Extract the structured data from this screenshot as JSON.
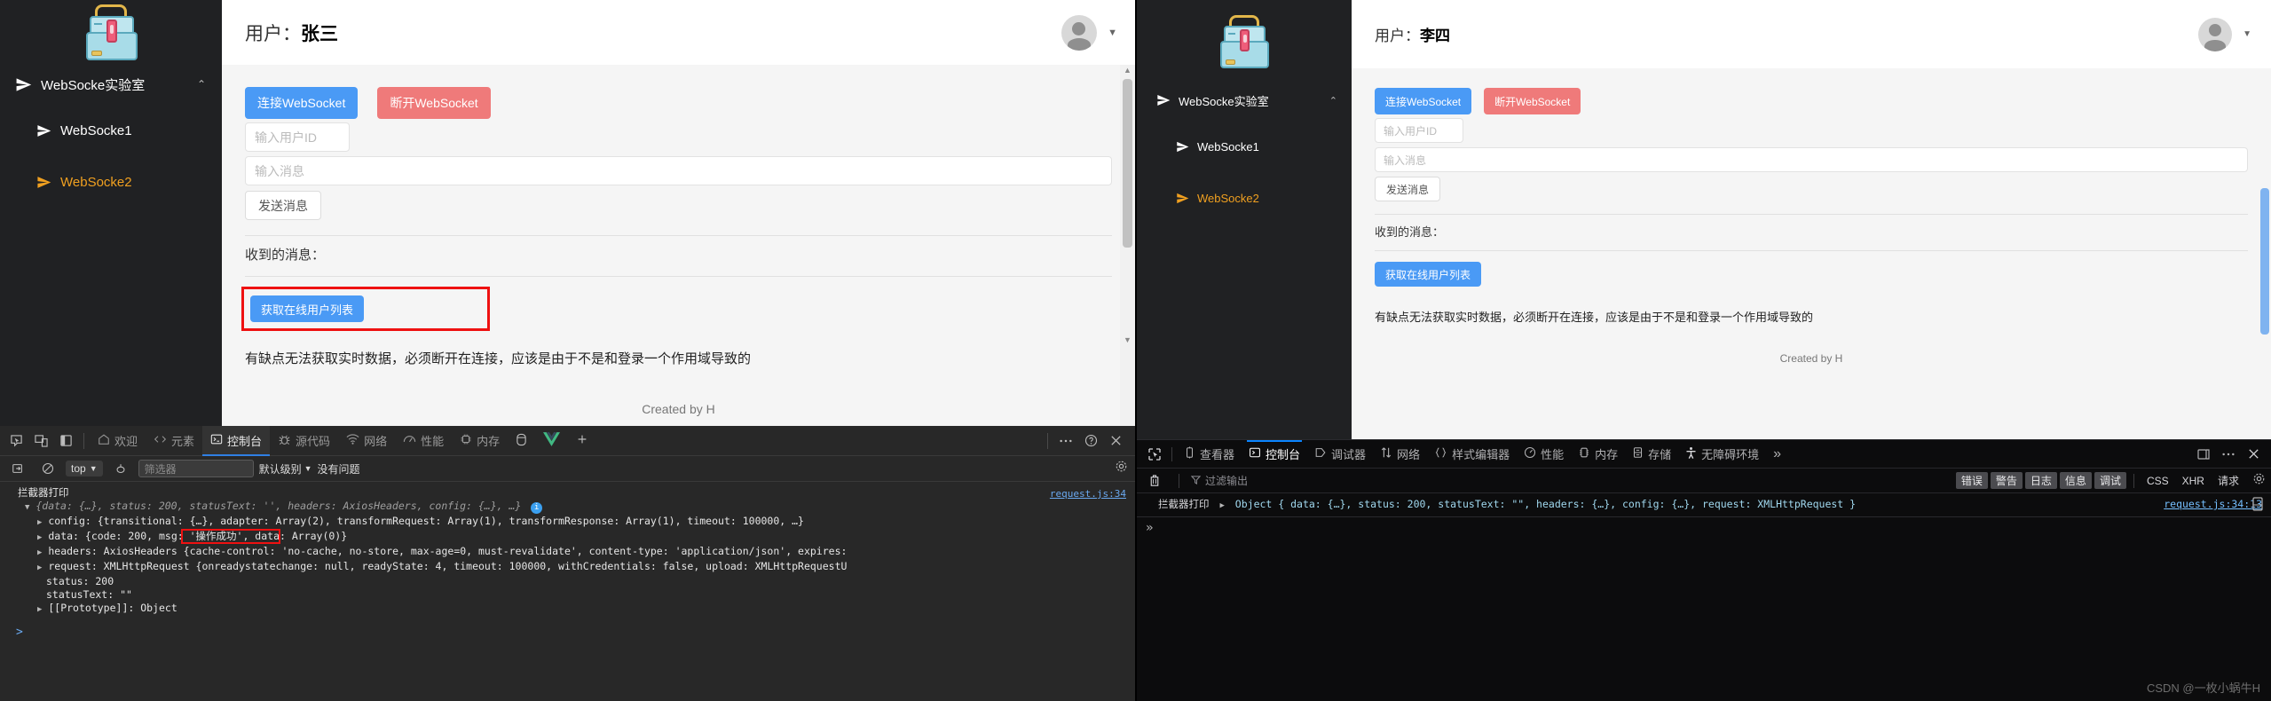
{
  "left_panel": {
    "app": {
      "sidebar": {
        "logo_name": "toolbox-logo",
        "items": [
          {
            "label": "WebSocke实验室",
            "caret": "⌃",
            "active": false,
            "level": 0
          },
          {
            "label": "WebSocke1",
            "active": false,
            "level": 1
          },
          {
            "label": "WebSocke2",
            "active": true,
            "level": 1
          }
        ]
      },
      "topbar": {
        "prefix": "用户：",
        "user": "张三"
      },
      "buttons": {
        "connect": "连接WebSocket",
        "disconnect": "断开WebSocket",
        "send": "发送消息",
        "get_online_users": "获取在线用户列表"
      },
      "inputs": {
        "user_id_placeholder": "输入用户ID",
        "message_placeholder": "输入消息"
      },
      "received_label": "收到的消息：",
      "note": "有缺点无法获取实时数据，必须断开在连接，应该是由于不是和登录一个作用域导致的",
      "credit": "Created by H"
    },
    "devtools": {
      "left_icons": [
        "inspect-icon",
        "device-toggle-icon",
        "dock-side-icon"
      ],
      "tabs": [
        {
          "label": "欢迎",
          "icon": "home-icon",
          "selected": false
        },
        {
          "label": "元素",
          "icon": "code-icon",
          "selected": false
        },
        {
          "label": "控制台",
          "icon": "console-icon",
          "selected": true
        },
        {
          "label": "源代码",
          "icon": "bug-icon",
          "selected": false
        },
        {
          "label": "网络",
          "icon": "network-icon",
          "selected": false
        },
        {
          "label": "性能",
          "icon": "performance-icon",
          "selected": false
        },
        {
          "label": "内存",
          "icon": "memory-icon",
          "selected": false
        }
      ],
      "extra_icons": [
        "storage-icon",
        "vue-icon",
        "plus-icon"
      ],
      "right_icons": [
        "more-icon",
        "help-icon",
        "close-icon"
      ],
      "filterbar": {
        "context": "top",
        "filter_placeholder": "筛选器",
        "level": "默认级别",
        "issues": "没有问题"
      },
      "console": {
        "source_link": "request.js:34",
        "header_text": "拦截器打印",
        "summary": "{data: {…}, status: 200, statusText: '', headers: AxiosHeaders, config: {…}, …}",
        "rows": [
          "config: {transitional: {…}, adapter: Array(2), transformRequest: Array(1), transformResponse: Array(1), timeout: 100000, …}",
          "data: {code: 200, msg: '操作成功', data: Array(0)}",
          "headers: AxiosHeaders {cache-control: 'no-cache, no-store, max-age=0, must-revalidate', content-type: 'application/json', expires:",
          "request: XMLHttpRequest {onreadystatechange: null, readyState: 4, timeout: 100000, withCredentials: false, upload: XMLHttpRequestU",
          "status: 200",
          "statusText: \"\"",
          "[[Prototype]]: Object"
        ],
        "highlight_fragment": "data: Array(0)"
      }
    }
  },
  "right_panel": {
    "app": {
      "sidebar": {
        "items": [
          {
            "label": "WebSocke实验室",
            "caret": "⌃",
            "active": false,
            "level": 0
          },
          {
            "label": "WebSocke1",
            "active": false,
            "level": 1
          },
          {
            "label": "WebSocke2",
            "active": true,
            "level": 1
          }
        ]
      },
      "topbar": {
        "prefix": "用户：",
        "user": "李四"
      },
      "buttons": {
        "connect": "连接WebSocket",
        "disconnect": "断开WebSocket",
        "send": "发送消息",
        "get_online_users": "获取在线用户列表"
      },
      "inputs": {
        "user_id_placeholder": "输入用户ID",
        "message_placeholder": "输入消息"
      },
      "received_label": "收到的消息：",
      "note": "有缺点无法获取实时数据，必须断开在连接，应该是由于不是和登录一个作用域导致的",
      "credit": "Created by H"
    },
    "devtools": {
      "tabs": [
        {
          "label": "查看器",
          "icon": "inspector-icon",
          "selected": false
        },
        {
          "label": "控制台",
          "icon": "console-icon",
          "selected": true
        },
        {
          "label": "调试器",
          "icon": "debugger-icon",
          "selected": false
        },
        {
          "label": "网络",
          "icon": "network-arrows-icon",
          "selected": false
        },
        {
          "label": "样式编辑器",
          "icon": "braces-icon",
          "selected": false
        },
        {
          "label": "性能",
          "icon": "gauge-icon",
          "selected": false
        },
        {
          "label": "内存",
          "icon": "memory-icon",
          "selected": false
        },
        {
          "label": "存储",
          "icon": "storage-icon",
          "selected": false
        },
        {
          "label": "无障碍环境",
          "icon": "accessibility-icon",
          "selected": false
        }
      ],
      "overflow": "»",
      "right_icons": [
        "dock-icon",
        "more-icon",
        "close-icon"
      ],
      "filterbar": {
        "trash_icon": "trash-icon",
        "filter_placeholder": "过滤输出",
        "severities": [
          "错误",
          "警告",
          "日志",
          "信息",
          "调试"
        ],
        "plain_filters": [
          "CSS",
          "XHR",
          "请求"
        ],
        "gear_icon": "gear-icon"
      },
      "console": {
        "label": "拦截器打印",
        "message": "Object { data: {…}, status: 200, statusText: \"\", headers: {…}, config: {…}, request: XMLHttpRequest }",
        "source_link": "request.js:34:13",
        "prompt": "»"
      }
    }
  },
  "watermark": "CSDN @一枚小蜗牛H"
}
